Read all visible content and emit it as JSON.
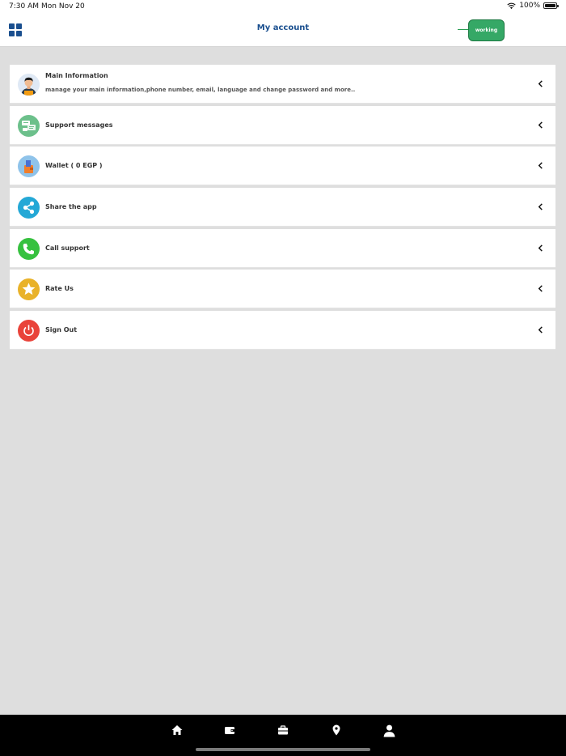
{
  "status_bar": {
    "time": "7:30 AM",
    "date": "Mon Nov 20",
    "battery": "100%"
  },
  "header": {
    "title": "My account",
    "working_label": "working"
  },
  "menu": [
    {
      "label": "Main Information",
      "sub": "manage your main information,phone number, email, language and change password and more..",
      "icon": "user-avatar-icon",
      "color": "#e9eef5"
    },
    {
      "label": "Support messages",
      "icon": "messages-icon",
      "color": "#6cc08b"
    },
    {
      "label": "Wallet ( 0 EGP )",
      "icon": "wallet-icon",
      "color": "#8fc3ea"
    },
    {
      "label": "Share the app",
      "icon": "share-icon",
      "color": "#24a8d6"
    },
    {
      "label": "Call support",
      "icon": "phone-icon",
      "color": "#36c13f"
    },
    {
      "label": "Rate Us",
      "icon": "star-icon",
      "color": "#e9b229"
    },
    {
      "label": "Sign Out",
      "icon": "power-icon",
      "color": "#e9433a"
    }
  ],
  "bottom_nav": [
    "home-icon",
    "wallet-icon",
    "briefcase-icon",
    "location-pin-icon",
    "profile-icon"
  ]
}
